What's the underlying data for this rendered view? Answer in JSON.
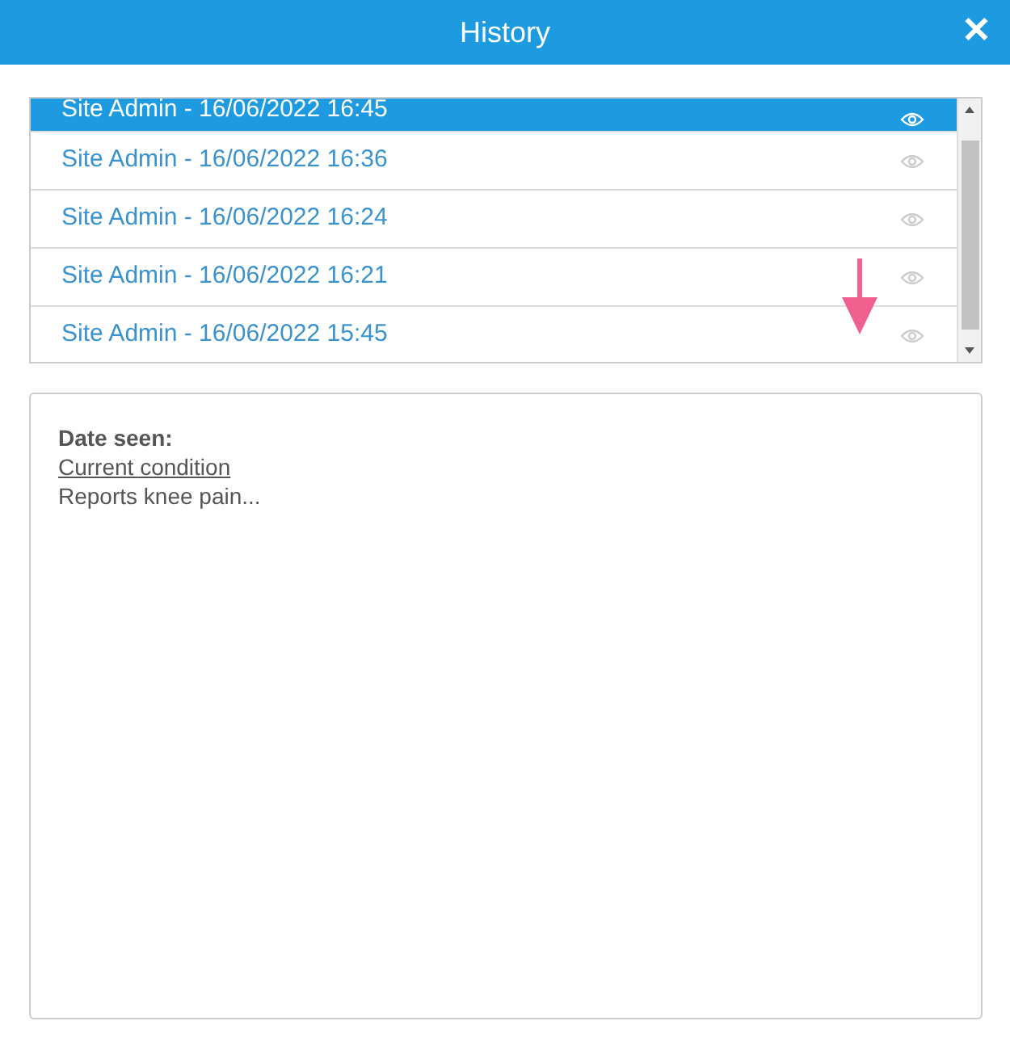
{
  "window": {
    "title": "History",
    "close": "✕"
  },
  "entries": [
    {
      "label": "Site Admin - 16/06/2022 16:45",
      "selected": true
    },
    {
      "label": "Site Admin - 16/06/2022 16:36",
      "selected": false
    },
    {
      "label": "Site Admin - 16/06/2022 16:24",
      "selected": false
    },
    {
      "label": "Site Admin - 16/06/2022 16:21",
      "selected": false
    },
    {
      "label": "Site Admin - 16/06/2022 15:45",
      "selected": false
    }
  ],
  "detail": {
    "heading": "Date seen:",
    "section": "Current condition",
    "text": "Reports knee pain..."
  }
}
